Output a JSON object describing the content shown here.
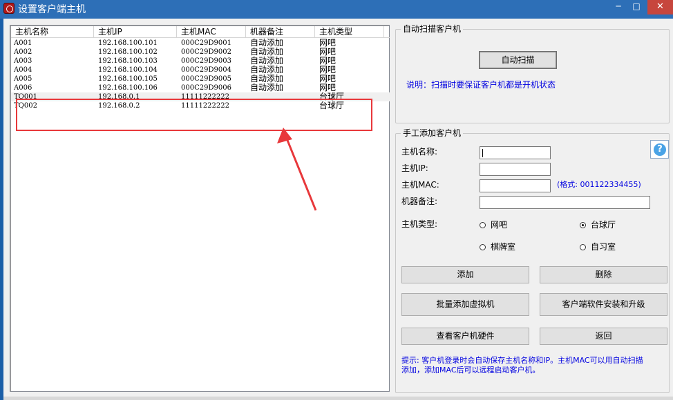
{
  "window": {
    "title": "设置客户端主机",
    "min_label": "─",
    "max_label": "□",
    "close_label": "✕"
  },
  "host_list": {
    "columns": [
      "主机名称",
      "主机IP",
      "主机MAC",
      "机器备注",
      "主机类型"
    ],
    "rows": [
      [
        "A001",
        "192.168.100.101",
        "000C29D9001",
        "自动添加",
        "网吧"
      ],
      [
        "A002",
        "192.168.100.102",
        "000C29D9002",
        "自动添加",
        "网吧"
      ],
      [
        "A003",
        "192.168.100.103",
        "000C29D9003",
        "自动添加",
        "网吧"
      ],
      [
        "A004",
        "192.168.100.104",
        "000C29D9004",
        "自动添加",
        "网吧"
      ],
      [
        "A005",
        "192.168.100.105",
        "000C29D9005",
        "自动添加",
        "网吧"
      ],
      [
        "A006",
        "192.168.100.106",
        "000C29D9006",
        "自动添加",
        "网吧"
      ],
      [
        "TQ001",
        "192.168.0.1",
        "11111222222",
        "",
        "台球厅"
      ],
      [
        "TQ002",
        "192.168.0.2",
        "11111222222",
        "",
        "台球厅"
      ]
    ]
  },
  "auto_scan": {
    "group_title": "自动扫描客户机",
    "scan_button": "自动扫描",
    "note": "说明：扫描时要保证客户机都是开机状态"
  },
  "manual_add": {
    "group_title": "手工添加客户机",
    "name_label": "主机名称:",
    "name_value": "",
    "ip_label": "主机IP:",
    "ip_value": "",
    "mac_label": "主机MAC:",
    "mac_value": "",
    "mac_format_hint": "(格式: 001122334455)",
    "remark_label": "机器备注:",
    "remark_value": "",
    "type_label": "主机类型:",
    "type_options": [
      "网吧",
      "台球厅",
      "棋牌室",
      "自习室"
    ],
    "selected_type": "台球厅",
    "help_icon": "question-icon",
    "add_button": "添加",
    "delete_button": "删除",
    "batch_add_button": "批量添加虚拟机",
    "client_install_button": "客户端软件安装和升级",
    "view_hardware_button": "查看客户机硬件",
    "back_button": "返回",
    "tip_line1": "提示: 客户机登录时会自动保存主机名称和IP。主机MAC可以用自动扫描",
    "tip_line2": "添加，添加MAC后可以远程启动客户机。"
  },
  "colors": {
    "title_bar": "#2d6fb7",
    "close_button": "#c7463d",
    "highlight_annotation": "#e8383b",
    "note_text": "#0000e0"
  }
}
